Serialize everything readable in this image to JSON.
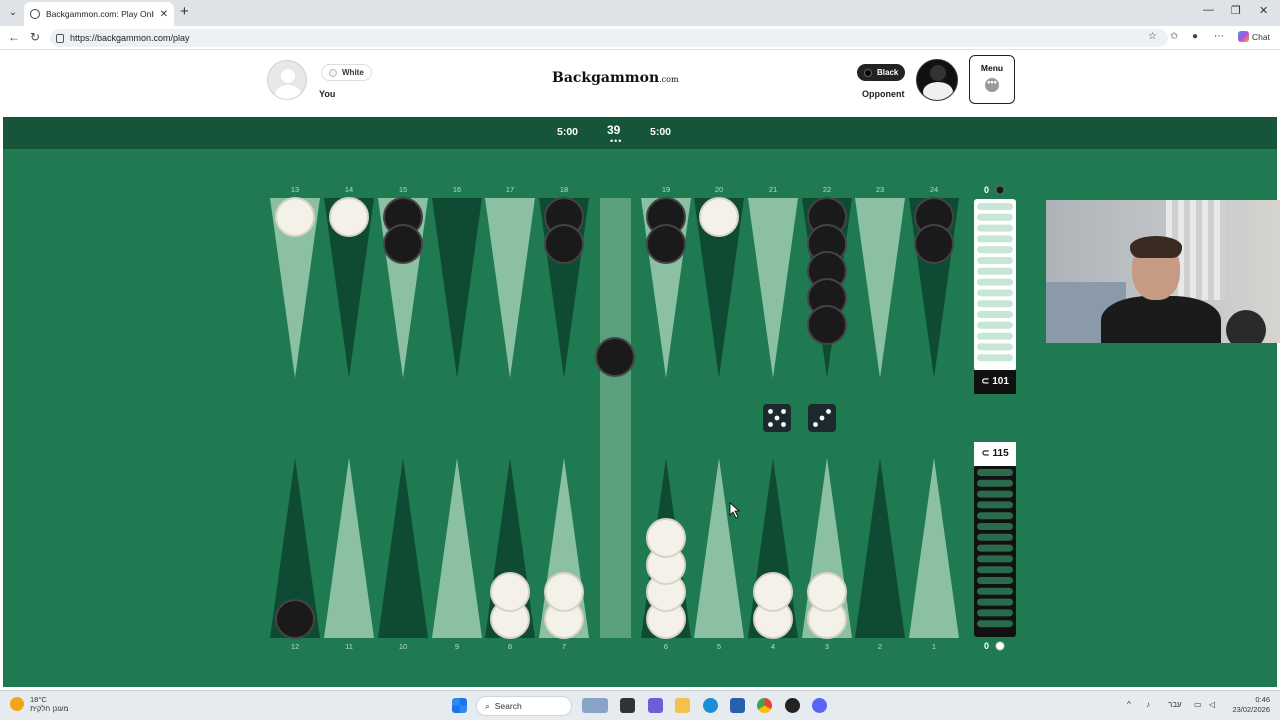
{
  "browser": {
    "tab_title": "Backgammon.com: Play Online Ba",
    "url": "https://backgammon.com/play",
    "chat_label": "Chat"
  },
  "header": {
    "logo_main": "Backgammon",
    "logo_suffix": ".com",
    "you": {
      "name": "You",
      "color_label": "White"
    },
    "opponent": {
      "name": "Opponent",
      "color_label": "Black"
    },
    "menu_label": "Menu",
    "menu_dots": "•••"
  },
  "timers": {
    "left": "5:00",
    "right": "5:00",
    "move_number": "39",
    "move_dots": "•••"
  },
  "board": {
    "colors": {
      "felt": "#1f7a52",
      "point_light": "#8cc0a3",
      "point_dark": "#0f4a32",
      "bar": "#5aa07d",
      "white_checker": "#f3f1e8",
      "black_checker": "#1a1a1a",
      "die": "#1c2a30"
    },
    "top_labels": [
      "13",
      "14",
      "15",
      "16",
      "17",
      "18",
      "19",
      "20",
      "21",
      "22",
      "23",
      "24"
    ],
    "bottom_labels": [
      "12",
      "11",
      "10",
      "9",
      "8",
      "7",
      "6",
      "5",
      "4",
      "3",
      "2",
      "1"
    ],
    "top_points": [
      {
        "point": "13",
        "color": "white",
        "count": 1
      },
      {
        "point": "14",
        "color": "white",
        "count": 1
      },
      {
        "point": "15",
        "color": "black",
        "count": 2
      },
      {
        "point": "16",
        "color": "none",
        "count": 0
      },
      {
        "point": "17",
        "color": "none",
        "count": 0
      },
      {
        "point": "18",
        "color": "black",
        "count": 2
      },
      {
        "point": "19",
        "color": "black",
        "count": 2
      },
      {
        "point": "20",
        "color": "white",
        "count": 1
      },
      {
        "point": "21",
        "color": "none",
        "count": 0
      },
      {
        "point": "22",
        "color": "black",
        "count": 5
      },
      {
        "point": "23",
        "color": "none",
        "count": 0
      },
      {
        "point": "24",
        "color": "black",
        "count": 2
      }
    ],
    "bottom_points": [
      {
        "point": "12",
        "color": "black",
        "count": 1
      },
      {
        "point": "11",
        "color": "none",
        "count": 0
      },
      {
        "point": "10",
        "color": "none",
        "count": 0
      },
      {
        "point": "9",
        "color": "none",
        "count": 0
      },
      {
        "point": "8",
        "color": "white",
        "count": 2
      },
      {
        "point": "7",
        "color": "white",
        "count": 2
      },
      {
        "point": "6",
        "color": "white",
        "count": 4
      },
      {
        "point": "5",
        "color": "none",
        "count": 0
      },
      {
        "point": "4",
        "color": "white",
        "count": 2
      },
      {
        "point": "3",
        "color": "white",
        "count": 2
      },
      {
        "point": "2",
        "color": "none",
        "count": 0
      },
      {
        "point": "1",
        "color": "none",
        "count": 0
      }
    ],
    "bar": {
      "black": 1,
      "white": 0
    },
    "dice": [
      5,
      3
    ],
    "pip_counts": {
      "black": "⊂ 101",
      "white": "⊂ 115"
    },
    "borne_off": {
      "black": "0",
      "white": "0"
    },
    "tray_slots": 15
  },
  "taskbar": {
    "weather_temp": "18°C",
    "weather_desc": "מעונן חלקית",
    "search_label": "Search",
    "lang": "עבר",
    "time": "0:46",
    "date": "23/02/2026"
  }
}
